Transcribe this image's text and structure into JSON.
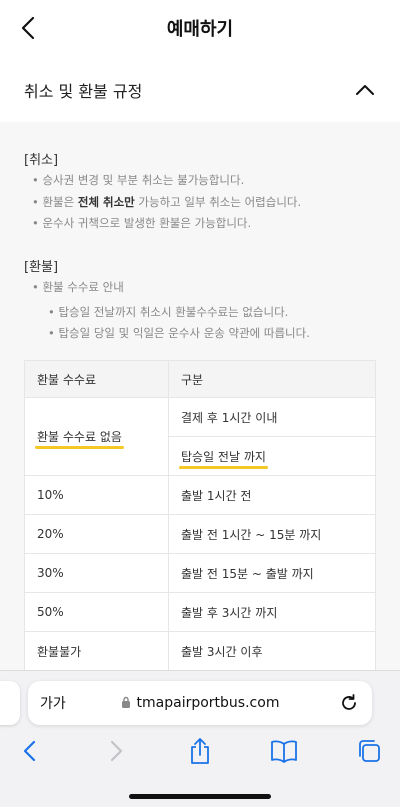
{
  "header": {
    "title": "예매하기"
  },
  "section": {
    "title": "취소 및 환불 규정"
  },
  "cancel": {
    "title": "[취소]",
    "items": [
      "승사권 변경 및 부분 취소는 불가능합니다.",
      {
        "pre": "환불은 ",
        "bold": "전체 취소만",
        "post": " 가능하고 일부 취소는 어렵습니다."
      },
      "운수사 귀책으로 발생한 환불은 가능합니다."
    ]
  },
  "refund": {
    "title": "[환불]",
    "guide": "환불 수수료 안내",
    "sub": [
      "탑승일 전날까지 취소시 환불수수료는 없습니다.",
      "탑승일 당일 및 익일은 운수사 운송 약관에 따릅니다."
    ]
  },
  "table": {
    "headers": [
      "환불 수수료",
      "구분"
    ],
    "merged_fee": "환불 수수료 없음",
    "merged_rows": [
      "결제 후 1시간 이내",
      "탑승일 전날 까지"
    ],
    "rows": [
      {
        "fee": "10%",
        "when": "출발 1시간 전"
      },
      {
        "fee": "20%",
        "when": "출발 전 1시간 ~ 15분 까지"
      },
      {
        "fee": "30%",
        "when": "출발 전 15분 ~ 출발 까지"
      },
      {
        "fee": "50%",
        "when": "출발 후 3시간 까지"
      },
      {
        "fee": "환불불가",
        "when": "출발 3시간 이후"
      }
    ]
  },
  "browser": {
    "aa_label": "가가",
    "url": "tmapairportbus.com"
  },
  "colors": {
    "highlight": "#f6c826",
    "accent": "#1a73e8"
  }
}
